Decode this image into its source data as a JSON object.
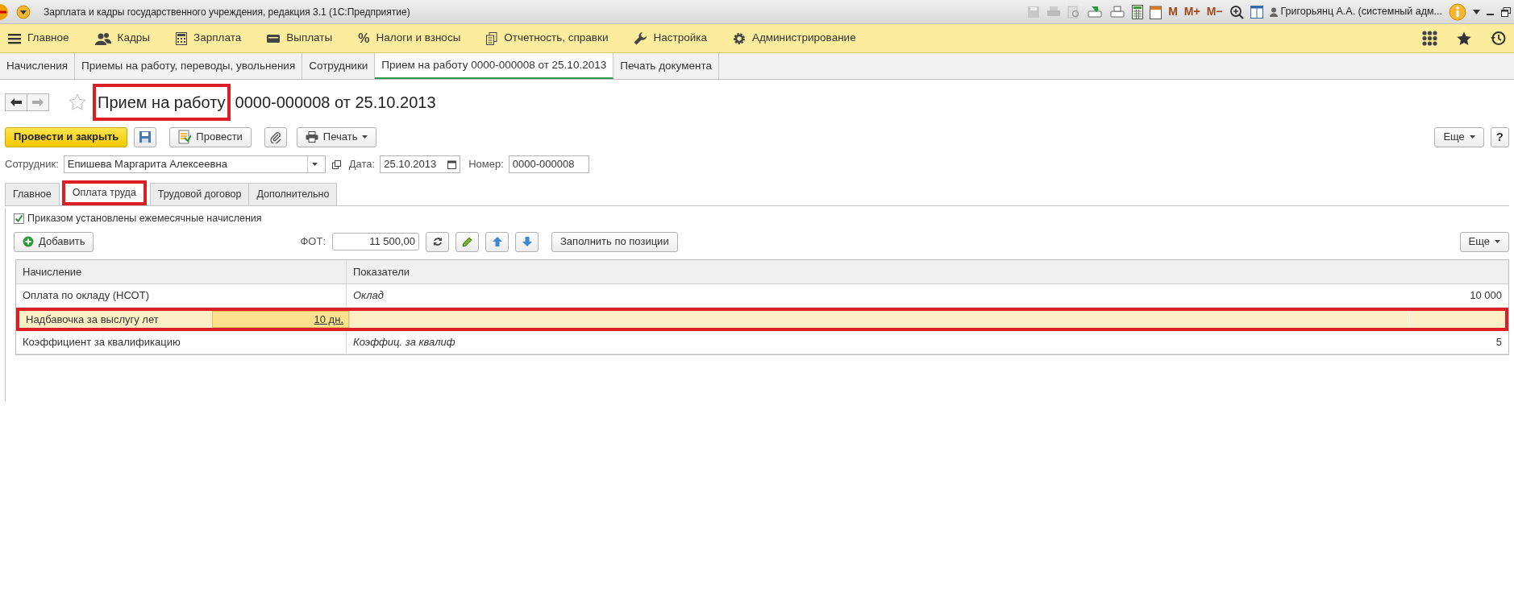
{
  "window": {
    "title": "Зарплата и кадры государственного учреждения, редакция 3.1  (1С:Предприятие)"
  },
  "system_toolbar": {
    "memory_buttons": [
      "M",
      "M+",
      "M−"
    ],
    "user": "Григорьянц А.А. (системный адм..."
  },
  "sections": [
    {
      "label": "Главное"
    },
    {
      "label": "Кадры"
    },
    {
      "label": "Зарплата"
    },
    {
      "label": "Выплаты"
    },
    {
      "label": "Налоги и взносы",
      "glyph": "%"
    },
    {
      "label": "Отчетность, справки"
    },
    {
      "label": "Настройка"
    },
    {
      "label": "Администрирование"
    }
  ],
  "open_tabs": [
    {
      "label": "Начисления",
      "selected": false
    },
    {
      "label": "Приемы на работу, переводы, увольнения",
      "selected": false
    },
    {
      "label": "Сотрудники",
      "selected": false
    },
    {
      "label": "Прием на работу 0000-000008 от 25.10.2013",
      "selected": true
    },
    {
      "label": "Печать документа",
      "selected": false
    }
  ],
  "document": {
    "title_parts": [
      {
        "text": "Прием на работу",
        "highlighted": true
      },
      {
        "text": "0000-000008 от 25.10.2013",
        "highlighted": false
      }
    ]
  },
  "command_bar": {
    "post_and_close": "Провести и закрыть",
    "post": "Провести",
    "print": "Печать",
    "more": "Еще",
    "help": "?"
  },
  "fields": [
    {
      "label": "Сотрудник:",
      "value": "Епишева Маргарита Алексеевна",
      "kind": "choice"
    },
    {
      "label": "Дата:",
      "value": "25.10.2013",
      "kind": "date"
    },
    {
      "label": "Номер:",
      "value": "0000-000008",
      "kind": "text"
    }
  ],
  "form_tabs": [
    {
      "label": "Главное",
      "selected": false,
      "highlighted": false
    },
    {
      "label": "Оплата труда",
      "selected": true,
      "highlighted": true
    },
    {
      "label": "Трудовой договор",
      "selected": false,
      "highlighted": false
    },
    {
      "label": "Дополнительно",
      "selected": false,
      "highlighted": false
    }
  ],
  "monthly_accruals_checkbox": {
    "label": "Приказом установлены ежемесячные начисления",
    "checked": true
  },
  "table_toolbar": {
    "add": "Добавить",
    "fot_label": "ФОТ:",
    "fot_value": "11 500,00",
    "fill": "Заполнить по позиции",
    "more": "Еще"
  },
  "table": {
    "columns": [
      "Начисление",
      "Показатели"
    ],
    "rows": [
      {
        "accrual": "Оплата по окладу (НСОТ)",
        "indicator": "Оклад",
        "value": "10 000",
        "selected": false,
        "highlighted": false
      },
      {
        "accrual": "Надбавочка за выслугу лет",
        "editing_value": "10 дн.",
        "selected": true,
        "highlighted": true
      },
      {
        "accrual": "Коэффициент за квалификацию",
        "indicator": "Коэффиц. за квалиф",
        "value": "5",
        "selected": false,
        "highlighted": false
      }
    ]
  }
}
